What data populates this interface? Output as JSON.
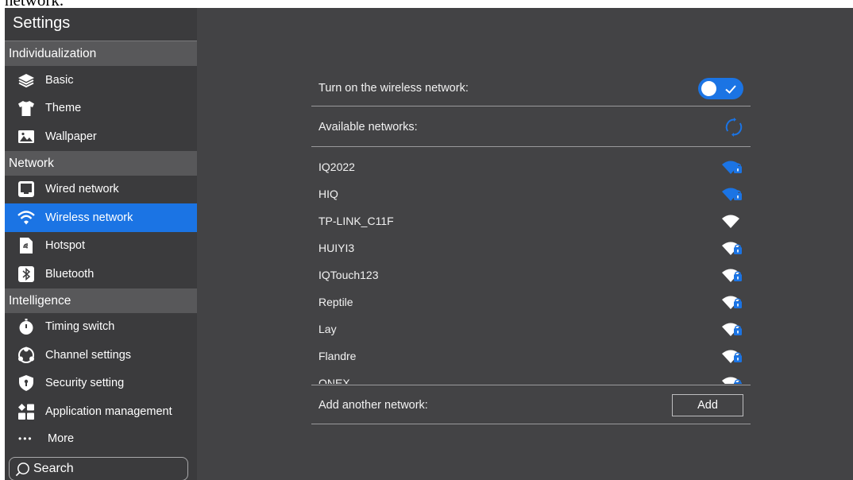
{
  "page_top_fragment": "network.",
  "sidebar": {
    "title": "Settings",
    "sections": [
      {
        "label": "Individualization",
        "items": [
          {
            "label": "Basic",
            "icon": "layers-icon",
            "active": false
          },
          {
            "label": "Theme",
            "icon": "tshirt-icon",
            "active": false
          },
          {
            "label": "Wallpaper",
            "icon": "image-icon",
            "active": false
          }
        ]
      },
      {
        "label": "Network",
        "items": [
          {
            "label": "Wired network",
            "icon": "monitor-icon",
            "active": false
          },
          {
            "label": "Wireless network",
            "icon": "wifi-icon",
            "active": true
          },
          {
            "label": "Hotspot",
            "icon": "hotspot-icon",
            "active": false
          },
          {
            "label": "Bluetooth",
            "icon": "bluetooth-icon",
            "active": false
          }
        ]
      },
      {
        "label": "Intelligence",
        "items": [
          {
            "label": "Timing switch",
            "icon": "stopwatch-icon",
            "active": false
          },
          {
            "label": "Channel settings",
            "icon": "channel-icon",
            "active": false
          },
          {
            "label": "Security setting",
            "icon": "shield-icon",
            "active": false
          },
          {
            "label": "Application management",
            "icon": "apps-grid-icon",
            "active": false
          }
        ]
      }
    ],
    "more_label": "More",
    "search_label": "Search"
  },
  "wireless": {
    "toggle_label": "Turn on the wireless network:",
    "toggle_on": true,
    "available_label": "Available networks:",
    "networks": [
      {
        "name": "IQ2022",
        "secured": true,
        "color": "blue"
      },
      {
        "name": "HIQ",
        "secured": true,
        "color": "blue"
      },
      {
        "name": "TP-LINK_C11F",
        "secured": false,
        "color": "white"
      },
      {
        "name": "HUIYI3",
        "secured": true,
        "color": "white"
      },
      {
        "name": "IQTouch123",
        "secured": true,
        "color": "white"
      },
      {
        "name": "Reptile",
        "secured": true,
        "color": "white"
      },
      {
        "name": "Lay",
        "secured": true,
        "color": "white"
      },
      {
        "name": "Flandre",
        "secured": true,
        "color": "white"
      },
      {
        "name": "ONEX",
        "secured": true,
        "color": "white"
      }
    ],
    "add_label": "Add another network:",
    "add_button": "Add"
  },
  "colors": {
    "accent": "#1b74e4",
    "sidebar_bg": "#3b3b3d",
    "section_bg": "#58585a",
    "main_bg": "#434345"
  }
}
